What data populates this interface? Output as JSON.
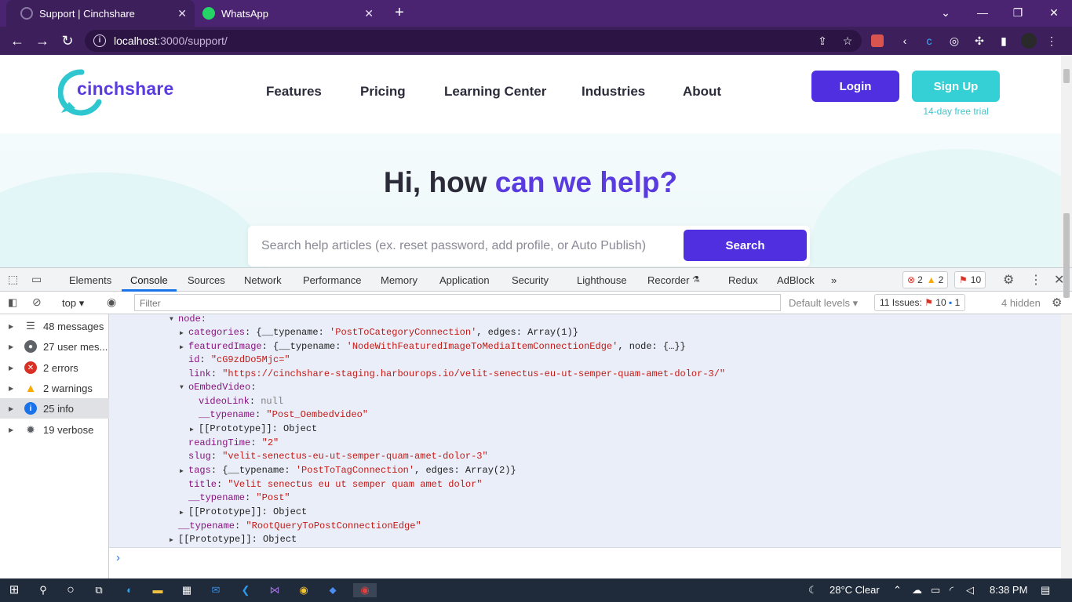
{
  "browser": {
    "tabs": [
      {
        "title": "Support | Cinchshare",
        "active": true
      },
      {
        "title": "WhatsApp",
        "active": false
      }
    ],
    "new_tab": "+",
    "url_host": "localhost",
    "url_rest": ":3000/support/",
    "window_controls": {
      "minimize": "—",
      "maximize": "❐",
      "close": "✕",
      "dropdown": "⌄"
    }
  },
  "site": {
    "logo_text": "cinchshare",
    "nav": [
      "Features",
      "Pricing",
      "Learning Center",
      "Industries",
      "About"
    ],
    "login": "Login",
    "signup": "Sign Up",
    "trial": "14-day free trial",
    "hero_plain": "Hi, how ",
    "hero_highlight": "can we help?",
    "search_placeholder": "Search help articles (ex. reset password, add profile, or Auto Publish)",
    "search_button": "Search"
  },
  "devtools": {
    "tabs": [
      "Elements",
      "Console",
      "Sources",
      "Network",
      "Performance",
      "Memory",
      "Application",
      "Security",
      "Lighthouse",
      "Recorder",
      "Redux",
      "AdBlock"
    ],
    "more": "»",
    "error_count": "2",
    "warning_count": "2",
    "issue_count": "10",
    "context": "top",
    "filter_placeholder": "Filter",
    "default_levels": "Default levels",
    "issues_label": "11 Issues:",
    "issues_errors": "10",
    "issues_info": "1",
    "hidden": "4 hidden",
    "sidebar": [
      {
        "label": "48 messages",
        "icon": "list-icon"
      },
      {
        "label": "27 user mes...",
        "icon": "user-icon"
      },
      {
        "label": "2 errors",
        "icon": "error-icon"
      },
      {
        "label": "2 warnings",
        "icon": "warning-icon"
      },
      {
        "label": "25 info",
        "icon": "info-icon"
      },
      {
        "label": "19 verbose",
        "icon": "bug-icon"
      }
    ],
    "console_lines": {
      "node": "node:",
      "categories_key": "categories",
      "categories_val1": "{__typename: ",
      "categories_str": "'PostToCategoryConnection'",
      "categories_val2": ", edges: Array(1)}",
      "featured_key": "featuredImage",
      "featured_val1": "{__typename: ",
      "featured_str": "'NodeWithFeaturedImageToMediaItemConnectionEdge'",
      "featured_val2": ", node: {…}}",
      "id_key": "id",
      "id_val": "\"cG9zdDo5Mjc=\"",
      "link_key": "link",
      "link_val": "\"https://cinchshare-staging.harbourops.io/velit-senectus-eu-ut-semper-quam-amet-dolor-3/\"",
      "oembed_key": "oEmbedVideo",
      "videolink_key": "videoLink",
      "videolink_val": "null",
      "typename_key": "__typename",
      "oembed_type": "\"Post_Oembedvideo\"",
      "proto": "[[Prototype]]",
      "proto_val": "Object",
      "reading_key": "readingTime",
      "reading_val": "\"2\"",
      "slug_key": "slug",
      "slug_val": "\"velit-senectus-eu-ut-semper-quam-amet-dolor-3\"",
      "tags_key": "tags",
      "tags_val1": "{__typename: ",
      "tags_str": "'PostToTagConnection'",
      "tags_val2": ", edges: Array(2)}",
      "title_key": "title",
      "title_val": "\"Velit senectus eu ut semper quam amet dolor\"",
      "post_type": "\"Post\"",
      "edge_type": "\"RootQueryToPostConnectionEdge\""
    },
    "prompt": "›"
  },
  "taskbar": {
    "weather": "28°C  Clear",
    "time": "8:38 PM"
  },
  "colors": {
    "brand_purple": "#4f2fe0",
    "brand_teal": "#34d0d6",
    "chrome_purple": "#4a2470"
  }
}
